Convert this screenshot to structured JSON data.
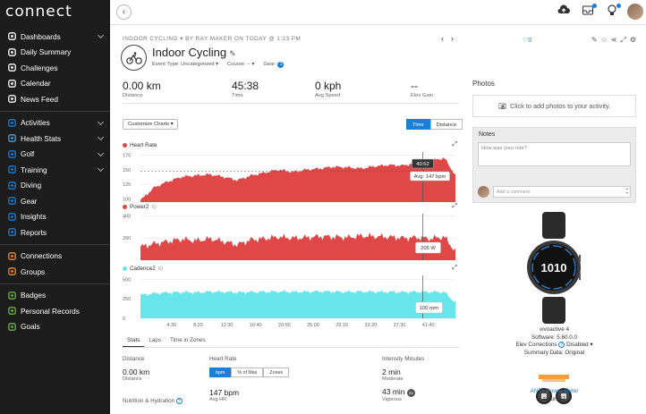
{
  "app": {
    "logo": "connect"
  },
  "sidebar": {
    "groups": [
      [
        {
          "label": "Dashboards",
          "icon": "dashboard-icon",
          "chevron": true
        },
        {
          "label": "Daily Summary",
          "icon": "summary-icon",
          "chevron": false
        },
        {
          "label": "Challenges",
          "icon": "challenges-icon",
          "chevron": false
        },
        {
          "label": "Calendar",
          "icon": "calendar-icon",
          "chevron": false
        },
        {
          "label": "News Feed",
          "icon": "newsfeed-icon",
          "chevron": false
        }
      ],
      [
        {
          "label": "Activities",
          "icon": "activities-icon",
          "chevron": true
        },
        {
          "label": "Health Stats",
          "icon": "heart-icon",
          "chevron": true
        },
        {
          "label": "Golf",
          "icon": "golf-icon",
          "chevron": true
        },
        {
          "label": "Training",
          "icon": "training-icon",
          "chevron": true
        },
        {
          "label": "Diving",
          "icon": "diving-icon",
          "chevron": false
        },
        {
          "label": "Gear",
          "icon": "gear-icon",
          "chevron": false
        },
        {
          "label": "Insights",
          "icon": "insights-icon",
          "chevron": false
        },
        {
          "label": "Reports",
          "icon": "reports-icon",
          "chevron": false
        }
      ],
      [
        {
          "label": "Connections",
          "icon": "connections-icon",
          "chevron": false
        },
        {
          "label": "Groups",
          "icon": "groups-icon",
          "chevron": false
        }
      ],
      [
        {
          "label": "Badges",
          "icon": "badges-icon",
          "chevron": false
        },
        {
          "label": "Personal Records",
          "icon": "records-icon",
          "chevron": false
        },
        {
          "label": "Goals",
          "icon": "goals-icon",
          "chevron": false
        }
      ]
    ],
    "icon_colors": {
      "dashboard-icon": "#ffffff",
      "summary-icon": "#ffffff",
      "challenges-icon": "#ffffff",
      "calendar-icon": "#ffffff",
      "newsfeed-icon": "#ffffff",
      "activities-icon": "#1a7fd6",
      "heart-icon": "#4aa3df",
      "golf-icon": "#1a7fd6",
      "training-icon": "#1a7fd6",
      "diving-icon": "#1a7fd6",
      "gear-icon": "#1a7fd6",
      "insights-icon": "#1a7fd6",
      "reports-icon": "#1a7fd6",
      "connections-icon": "#f28c28",
      "groups-icon": "#f28c28",
      "badges-icon": "#6db33f",
      "records-icon": "#6db33f",
      "goals-icon": "#6db33f"
    }
  },
  "activity": {
    "breadcrumb": "INDOOR CYCLING  ▾  BY RAY MAKER ON TODAY @ 1:23 PM",
    "title": "Indoor Cycling",
    "event_type": "Event Type: Uncategorized ▾",
    "course": "Course: -- ▾",
    "gear": "Gear:",
    "gear_count": "1",
    "likes": "0",
    "stats": [
      {
        "value": "0.00 km",
        "label": "Distance"
      },
      {
        "value": "45:38",
        "label": "Time"
      },
      {
        "value": "0 kph",
        "label": "Avg Speed"
      },
      {
        "value": "--",
        "label": "Elev Gain"
      }
    ]
  },
  "charts": {
    "customize": "Customize Charts ▾",
    "toggle": [
      "Time",
      "Distance"
    ],
    "active_toggle": "Time",
    "colors": {
      "heart_rate": "#e04848",
      "power": "#e04848",
      "cadence": "#66e6ea"
    }
  },
  "chart_data": [
    {
      "type": "area",
      "title": "Heart Rate",
      "yticks": [
        "175",
        "150",
        "125",
        "100"
      ],
      "ylim": [
        95,
        180
      ],
      "x": [
        0,
        2,
        4,
        6,
        8,
        10,
        12,
        14,
        16,
        18,
        20,
        22,
        24,
        26,
        28,
        30,
        32,
        34,
        36,
        38,
        40,
        42,
        44,
        45.6
      ],
      "values": [
        98,
        120,
        130,
        138,
        140,
        142,
        138,
        132,
        140,
        145,
        150,
        146,
        150,
        152,
        155,
        154,
        152,
        156,
        158,
        157,
        162,
        165,
        170,
        140
      ],
      "tooltip_time": "40:52",
      "tooltip_value": "Avg: 147 bpm",
      "avg_line": 147
    },
    {
      "type": "area",
      "title": "Power2",
      "sub": "IQ",
      "yticks": [
        "400",
        "200"
      ],
      "ylim": [
        0,
        420
      ],
      "x": [
        0,
        2,
        4,
        6,
        8,
        10,
        12,
        14,
        16,
        18,
        20,
        22,
        24,
        26,
        28,
        30,
        32,
        34,
        36,
        38,
        40,
        42,
        44,
        45.6
      ],
      "values": [
        120,
        150,
        170,
        190,
        175,
        195,
        170,
        140,
        185,
        195,
        210,
        200,
        205,
        215,
        210,
        205,
        220,
        215,
        210,
        200,
        205,
        195,
        210,
        80
      ],
      "tooltip_value": "205 W"
    },
    {
      "type": "area",
      "title": "Cadence2",
      "sub": "IQ",
      "yticks": [
        "500",
        "250",
        "0"
      ],
      "ylim": [
        0,
        550
      ],
      "x": [
        0,
        2,
        4,
        6,
        8,
        10,
        12,
        14,
        16,
        18,
        20,
        22,
        24,
        26,
        28,
        30,
        32,
        34,
        36,
        38,
        40,
        42,
        44,
        45.6
      ],
      "values": [
        300,
        320,
        330,
        335,
        330,
        340,
        338,
        332,
        336,
        340,
        342,
        338,
        340,
        344,
        340,
        338,
        342,
        340,
        338,
        336,
        340,
        338,
        336,
        200
      ],
      "tooltip_value": "100 rpm",
      "xticks": [
        "4:30",
        "8:20",
        "12:30",
        "16:40",
        "20:50",
        "25:00",
        "29:10",
        "33:20",
        "37:30",
        "41:40"
      ]
    }
  ],
  "tabs": [
    "Stats",
    "Laps",
    "Time in Zones"
  ],
  "active_tab": "Stats",
  "bottom": {
    "distance_head": "Distance",
    "distance_val": "0.00 km",
    "distance_sub": "Distance",
    "nutrition": "Nutrition & Hydration",
    "hr_head": "Heart Rate",
    "hr_toggle": [
      "bpm",
      "% of Max",
      "Zones"
    ],
    "hr_val": "147 bpm",
    "hr_sub": "Avg HR",
    "im_head": "Intensity Minutes",
    "im_mod_val": "2 min",
    "im_mod_sub": "Moderate",
    "im_vig_val": "43 min",
    "im_vig_badge": "2x",
    "im_vig_sub": "Vigorous"
  },
  "right": {
    "photos_label": "Photos",
    "photos_cta": "Click to add photos to your activity.",
    "notes_label": "Notes",
    "notes_placeholder": "How was your ride?",
    "comment_placeholder": "Add a comment",
    "device_name": "vivoactive 4",
    "software": "Software: 5.60.0.0",
    "elev_corr_label": "Elev Corrections",
    "elev_corr_value": "Disabled ▾",
    "summary": "Summary Data: Original",
    "watch_face": "1010",
    "ant_name": "ANT+ Power Meter",
    "ant_user": "takura87"
  }
}
